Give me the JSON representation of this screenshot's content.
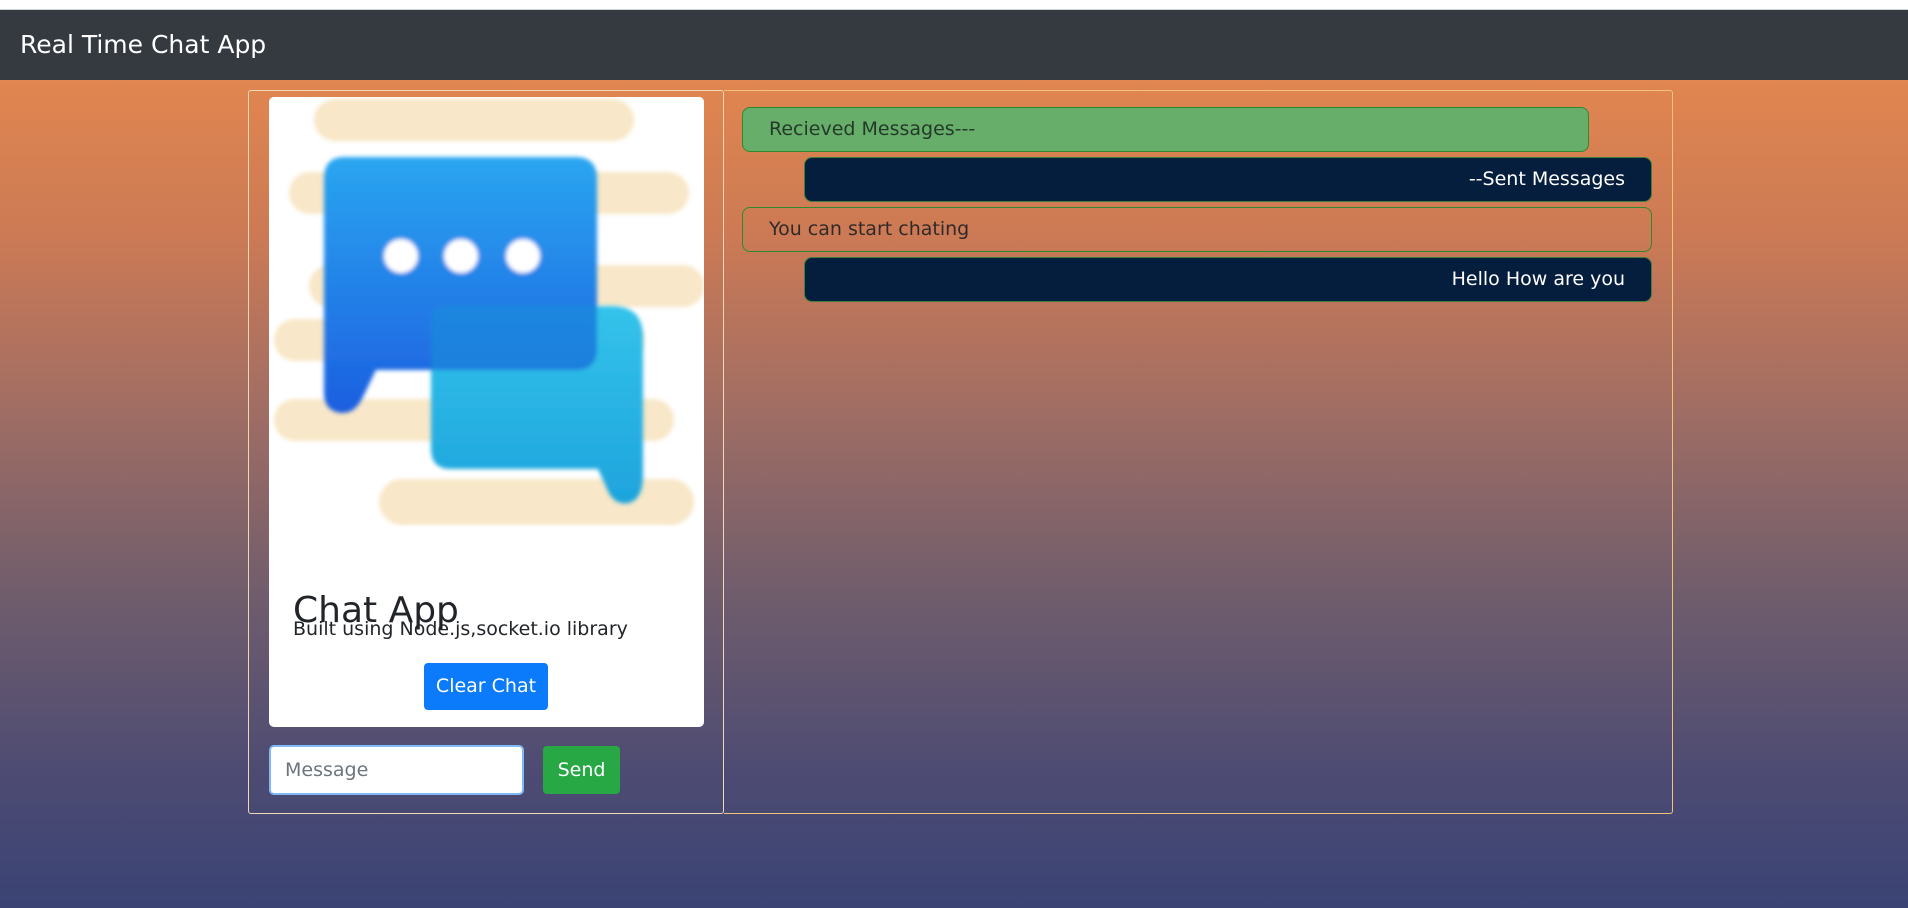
{
  "navbar": {
    "title": "Real Time Chat App"
  },
  "card": {
    "image_icon": "chat-bubbles-illustration",
    "title": "Chat App",
    "description": "Built using Node.js,socket.io library",
    "clear_button_label": "Clear Chat"
  },
  "composer": {
    "placeholder": "Message",
    "value": "",
    "send_label": "Send"
  },
  "messages": [
    {
      "type": "received",
      "text": "Recieved Messages---"
    },
    {
      "type": "sent",
      "text": "--Sent Messages"
    },
    {
      "type": "received",
      "text": "You can start chating"
    },
    {
      "type": "sent",
      "text": "Hello How are you"
    }
  ],
  "colors": {
    "navbar": "#343a40",
    "primary_button": "#0b7bfb",
    "send_button": "#28a745",
    "received_bubble": "#66ae6a",
    "sent_bubble": "#051e3d"
  }
}
